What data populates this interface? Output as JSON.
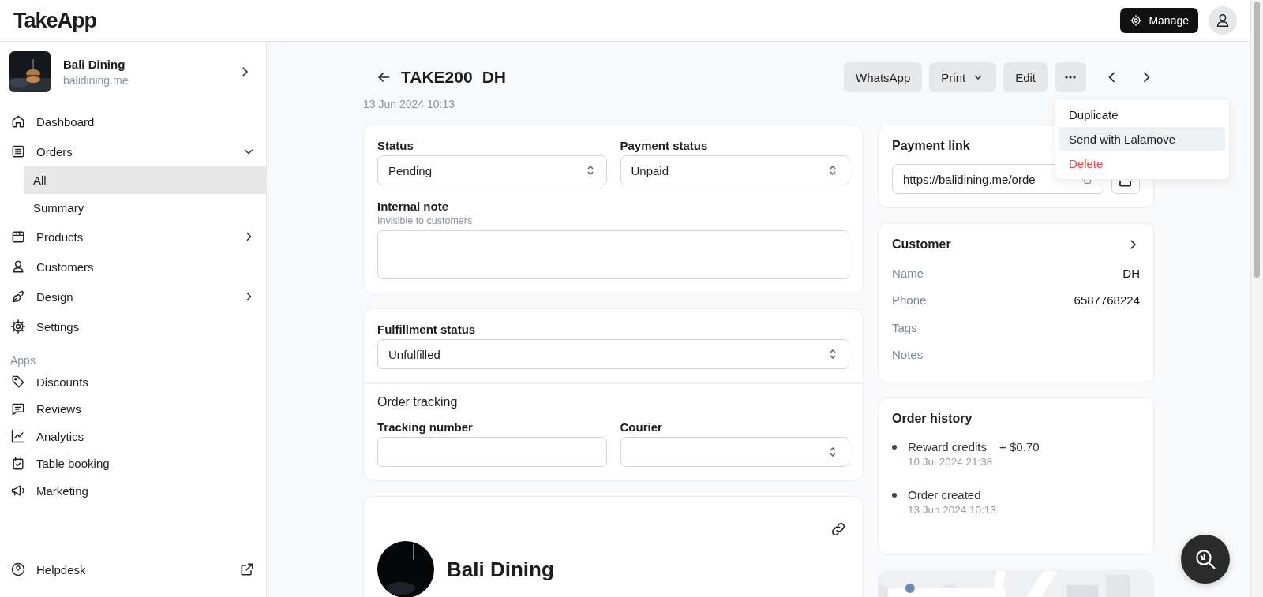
{
  "header": {
    "logo": "TakeApp",
    "manage_button": "Manage"
  },
  "store": {
    "name": "Bali Dining",
    "domain": "balidining.me"
  },
  "sidebar": {
    "items": [
      {
        "label": "Dashboard",
        "selected": false
      },
      {
        "label": "Orders",
        "selected": false,
        "expanded": true,
        "children": [
          {
            "label": "All",
            "selected": true
          },
          {
            "label": "Summary",
            "selected": false
          }
        ]
      },
      {
        "label": "Products",
        "selected": false,
        "expanded": false
      },
      {
        "label": "Customers",
        "selected": false
      },
      {
        "label": "Design",
        "selected": false,
        "expanded": false
      },
      {
        "label": "Settings",
        "selected": false
      }
    ],
    "apps_heading": "Apps",
    "apps": [
      {
        "label": "Discounts",
        "selected": false
      },
      {
        "label": "Reviews",
        "selected": false
      },
      {
        "label": "Analytics",
        "selected": false
      },
      {
        "label": "Table booking",
        "selected": false
      },
      {
        "label": "Marketing",
        "selected": false
      }
    ],
    "helpdesk": "Helpdesk"
  },
  "order": {
    "number": "TAKE200",
    "customer": "DH",
    "date": "13 Jun 2024 10:13"
  },
  "actions": [
    {
      "label": "WhatsApp",
      "kind": "plain"
    },
    {
      "label": "Print",
      "kind": "dropdown"
    },
    {
      "label": "Edit",
      "kind": "plain"
    }
  ],
  "menu": {
    "items": [
      {
        "label": "Duplicate",
        "kind": "normal",
        "selected": false
      },
      {
        "label": "Send with Lalamove",
        "kind": "normal",
        "selected": true
      },
      {
        "label": "Delete",
        "kind": "danger",
        "selected": false
      }
    ]
  },
  "status_card": {
    "status_label": "Status",
    "status": "Pending",
    "payment_label": "Payment status",
    "payment": "Unpaid",
    "note_label": "Internal note",
    "note_hint": "Invisible to customers"
  },
  "fulfillment_card": {
    "label": "Fulfillment status",
    "value": "Unfulfilled",
    "tracking_title": "Order tracking",
    "tracking_label": "Tracking number",
    "courier_label": "Courier"
  },
  "store_card": {
    "name": "Bali Dining"
  },
  "payment_link": {
    "title": "Payment link",
    "url": "https://balidining.me/orde"
  },
  "customer": {
    "title": "Customer",
    "fields": [
      {
        "label": "Name",
        "value": "DH"
      },
      {
        "label": "Phone",
        "value": "6587768224"
      },
      {
        "label": "Tags"
      },
      {
        "label": "Notes"
      }
    ]
  },
  "order_history": {
    "title": "Order history",
    "events": [
      {
        "title": "Reward credits",
        "amount": "+ $0.70",
        "time": "10 Jul 2024 21:38"
      },
      {
        "title": "Order created",
        "time": "13 Jun 2024 10:13"
      }
    ]
  }
}
